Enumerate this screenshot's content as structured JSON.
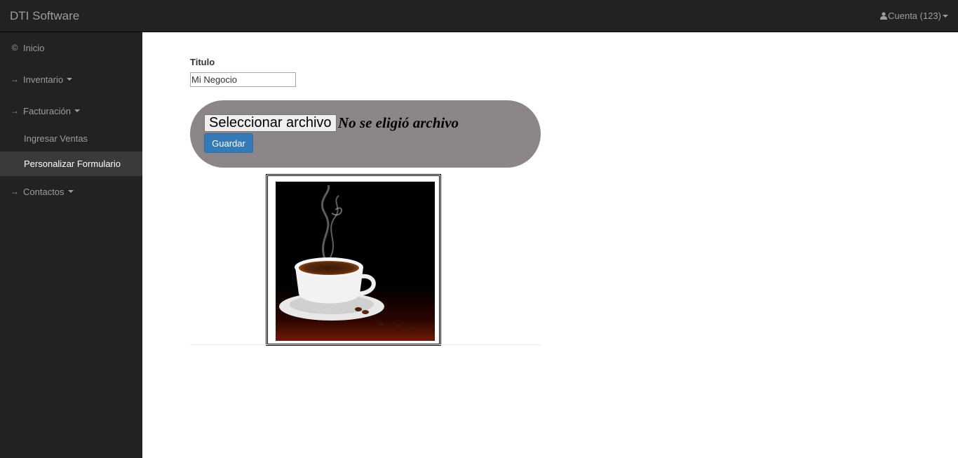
{
  "app": {
    "brand": "DTI Software"
  },
  "header": {
    "account_label": "Cuenta (123)"
  },
  "sidebar": {
    "items": [
      {
        "label": "Inicio",
        "icon": "copyright-icon"
      },
      {
        "label": "Inventario",
        "icon": "arrow-right-icon"
      },
      {
        "label": "Facturación",
        "icon": "arrow-right-icon"
      },
      {
        "label": "Contactos",
        "icon": "arrow-right-icon"
      }
    ],
    "subitems": [
      {
        "label": "Ingresar Ventas"
      },
      {
        "label": "Personalizar Formulario",
        "active": true
      }
    ]
  },
  "form": {
    "title_label": "Titulo",
    "title_value": "Mi Negocio",
    "file_button_label": "Seleccionar archivo",
    "file_status": "No se eligió archivo",
    "save_label": "Guardar"
  },
  "colors": {
    "navbar": "#222222",
    "panel": "#8c8689",
    "primary": "#337ab7"
  }
}
